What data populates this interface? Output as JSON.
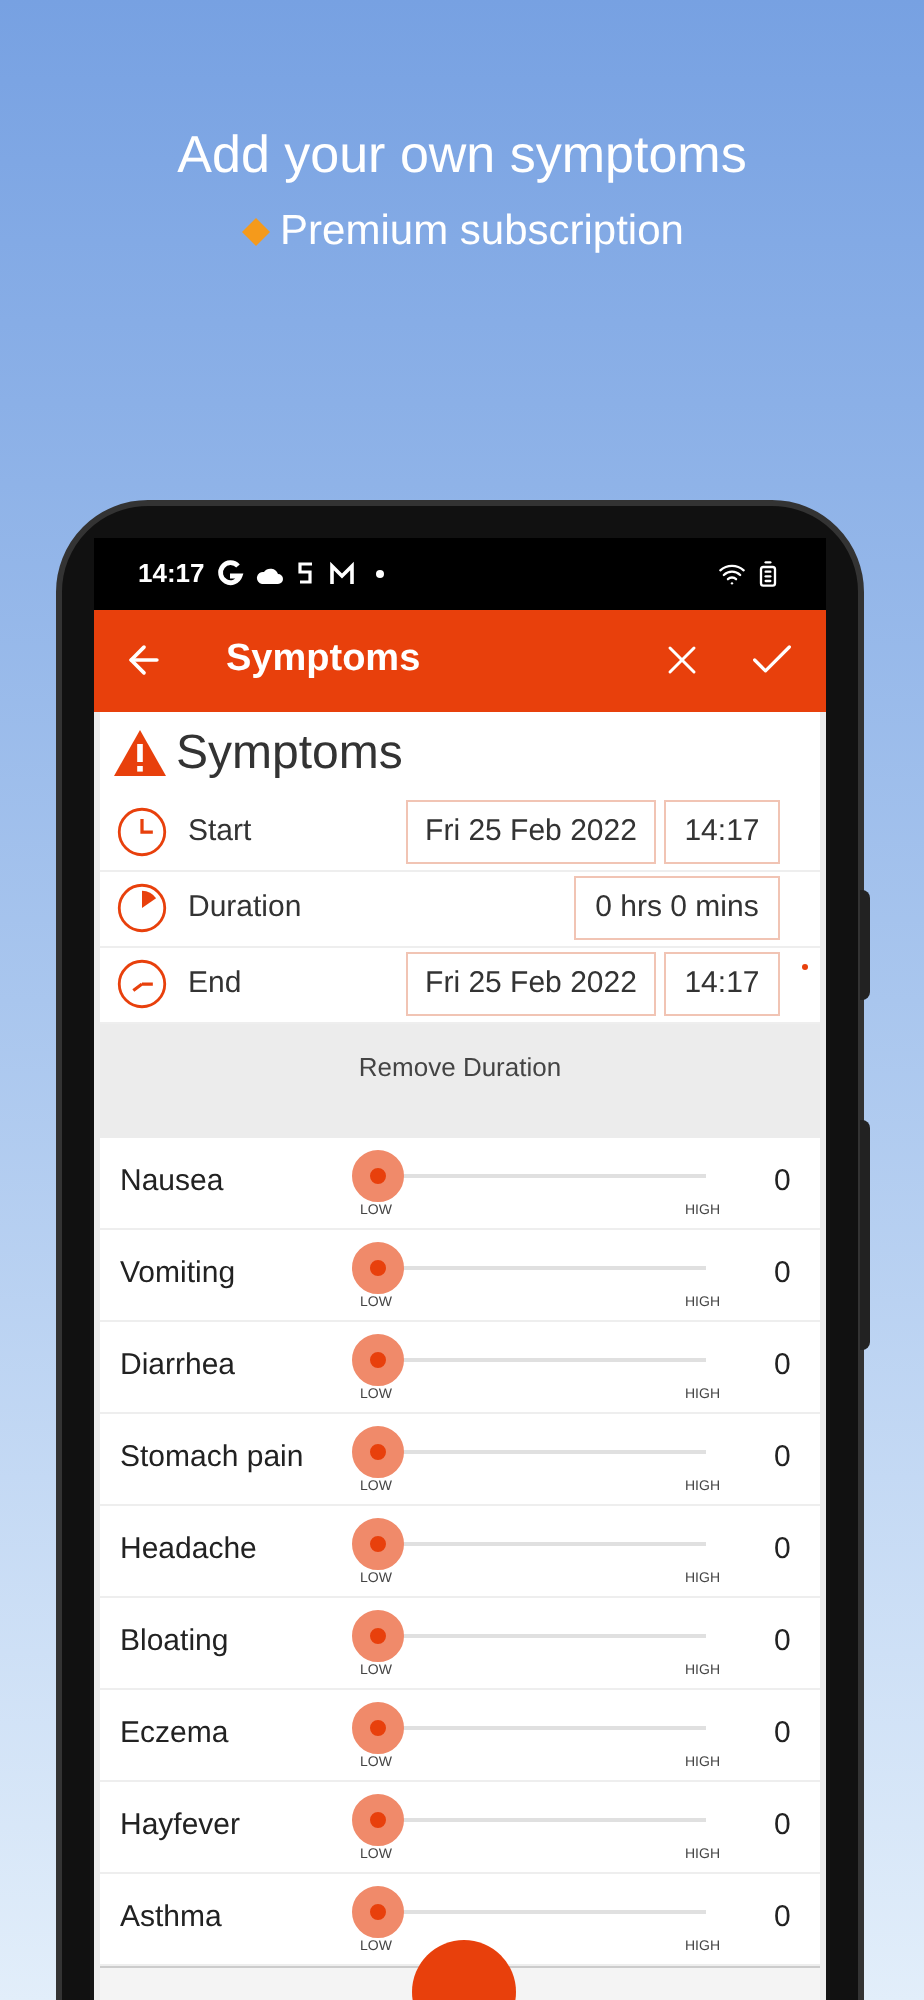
{
  "promo": {
    "title": "Add your own symptoms",
    "subtitle": "Premium subscription"
  },
  "status_bar": {
    "time": "14:17"
  },
  "app_bar": {
    "title": "Symptoms"
  },
  "section": {
    "title": "Symptoms"
  },
  "times": [
    {
      "kind": "start",
      "label": "Start",
      "date": "Fri 25 Feb 2022",
      "time": "14:17"
    },
    {
      "kind": "duration",
      "label": "Duration",
      "value": "0 hrs 0 mins"
    },
    {
      "kind": "end",
      "label": "End",
      "date": "Fri 25 Feb 2022",
      "time": "14:17"
    }
  ],
  "remove_duration": "Remove Duration",
  "symptoms": [
    {
      "name": "Nausea",
      "level": 0,
      "value": "0",
      "low": "LOW",
      "high": "HIGH"
    },
    {
      "name": "Vomiting",
      "level": 0,
      "value": "0",
      "low": "LOW",
      "high": "HIGH"
    },
    {
      "name": "Diarrhea",
      "level": 0,
      "value": "0",
      "low": "LOW",
      "high": "HIGH"
    },
    {
      "name": "Stomach pain",
      "level": 0,
      "value": "0",
      "low": "LOW",
      "high": "HIGH"
    },
    {
      "name": "Headache",
      "level": 0,
      "value": "0",
      "low": "LOW",
      "high": "HIGH"
    },
    {
      "name": "Bloating",
      "level": 0,
      "value": "0",
      "low": "LOW",
      "high": "HIGH"
    },
    {
      "name": "Eczema",
      "level": 0,
      "value": "0",
      "low": "LOW",
      "high": "HIGH"
    },
    {
      "name": "Hayfever",
      "level": 0,
      "value": "0",
      "low": "LOW",
      "high": "HIGH"
    },
    {
      "name": "Asthma",
      "level": 0,
      "value": "0",
      "low": "LOW",
      "high": "HIGH"
    }
  ]
}
